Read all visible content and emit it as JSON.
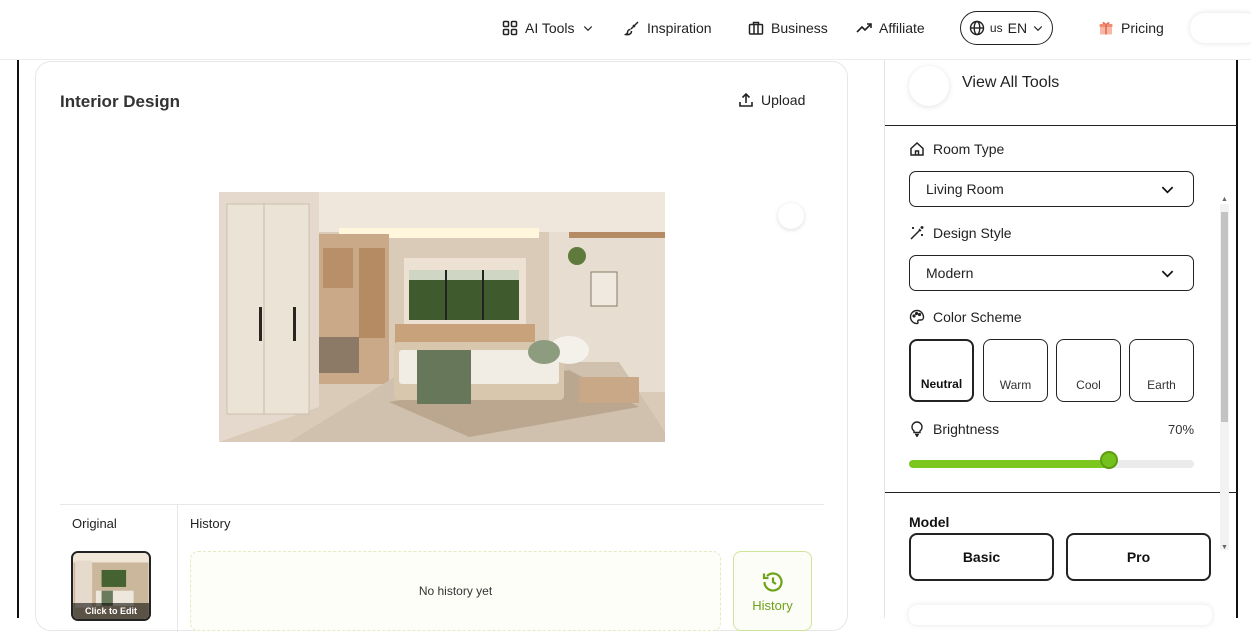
{
  "nav": {
    "ai_tools": "AI Tools",
    "inspiration": "Inspiration",
    "business": "Business",
    "affiliate": "Affiliate",
    "lang_flag": "us",
    "lang_code": "EN",
    "pricing": "Pricing"
  },
  "main": {
    "title": "Interior Design",
    "upload_label": "Upload",
    "original_label": "Original",
    "history_label": "History",
    "thumb_caption": "Click to Edit",
    "no_history": "No history yet",
    "history_button": "History"
  },
  "panel": {
    "view_all": "View All Tools",
    "room_type_label": "Room Type",
    "room_type_value": "Living Room",
    "design_style_label": "Design Style",
    "design_style_value": "Modern",
    "color_scheme_label": "Color Scheme",
    "color_schemes": [
      "Neutral",
      "Warm",
      "Cool",
      "Earth"
    ],
    "selected_color_scheme": "Neutral",
    "brightness_label": "Brightness",
    "brightness_value": "70%",
    "brightness_fraction": 0.7,
    "model_label": "Model",
    "models": [
      "Basic",
      "Pro"
    ]
  },
  "icons": {
    "ai_tools": "grid-icon",
    "inspiration": "brush-icon",
    "business": "briefcase-icon",
    "affiliate": "trending-up-icon",
    "language": "globe-icon",
    "pricing": "gift-icon",
    "upload": "upload-icon",
    "room_type": "home-icon",
    "design_style": "magic-wand-icon",
    "color_scheme": "palette-icon",
    "brightness": "lightbulb-icon",
    "history": "history-icon"
  },
  "colors": {
    "accent": "#7cc71f",
    "accent_dark": "#6da21a",
    "border": "#222222"
  }
}
